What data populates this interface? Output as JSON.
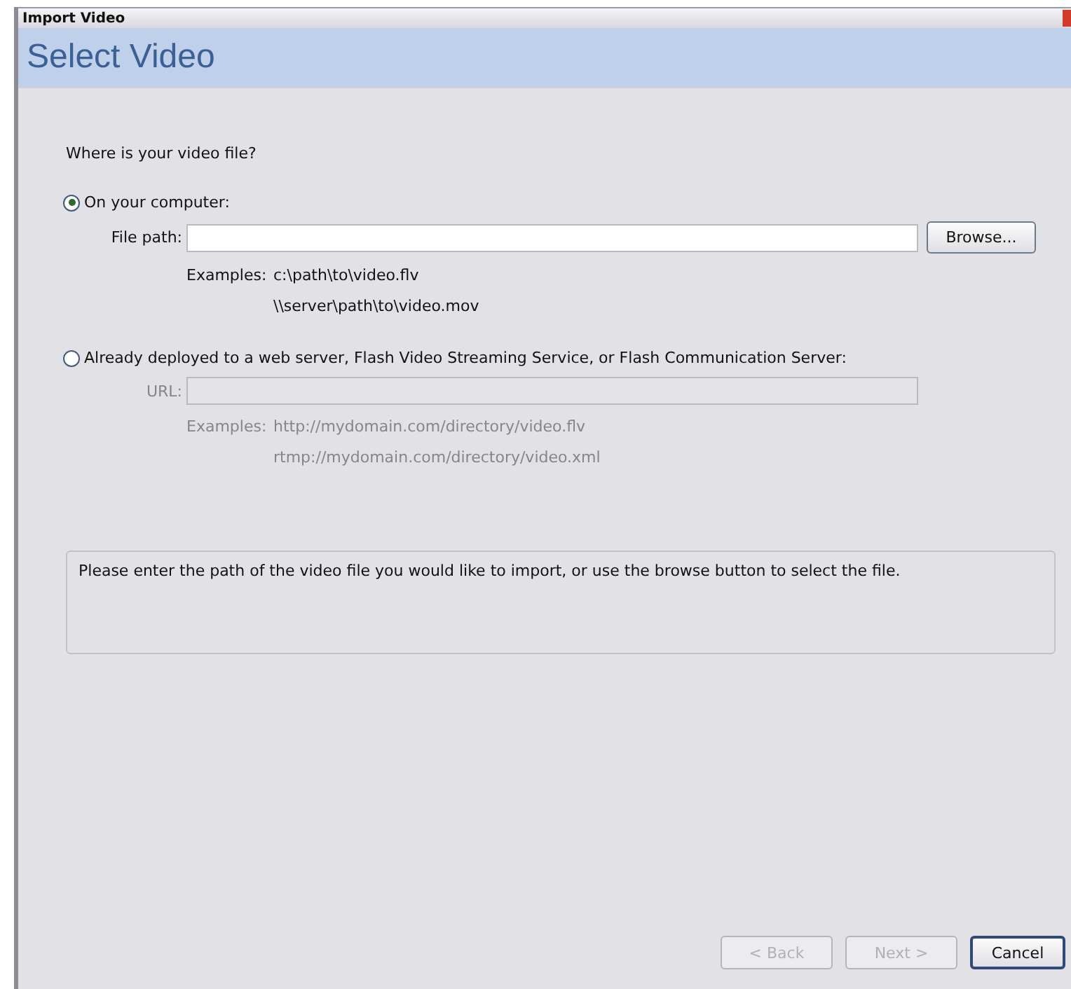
{
  "window": {
    "title": "Import Video"
  },
  "header": {
    "title": "Select Video"
  },
  "question": "Where is your video file?",
  "options": [
    {
      "label": "On your computer:",
      "selected": true,
      "field_label": "File path:",
      "browse": "Browse...",
      "examples_label": "Examples:",
      "examples": [
        "c:\\path\\to\\video.flv",
        "\\\\server\\path\\to\\video.mov"
      ]
    },
    {
      "label": "Already deployed to a web server, Flash Video Streaming Service, or Flash Communication Server:",
      "selected": false,
      "field_label": "URL:",
      "examples_label": "Examples:",
      "examples": [
        "http://mydomain.com/directory/video.flv",
        "rtmp://mydomain.com/directory/video.xml"
      ]
    }
  ],
  "message": "Please enter the path of the video file you would like to import, or use the browse button to select the file.",
  "buttons": [
    {
      "label": "< Back",
      "disabled": true,
      "default": false
    },
    {
      "label": "Next >",
      "disabled": true,
      "default": false
    },
    {
      "label": "Cancel",
      "disabled": false,
      "default": true
    }
  ]
}
